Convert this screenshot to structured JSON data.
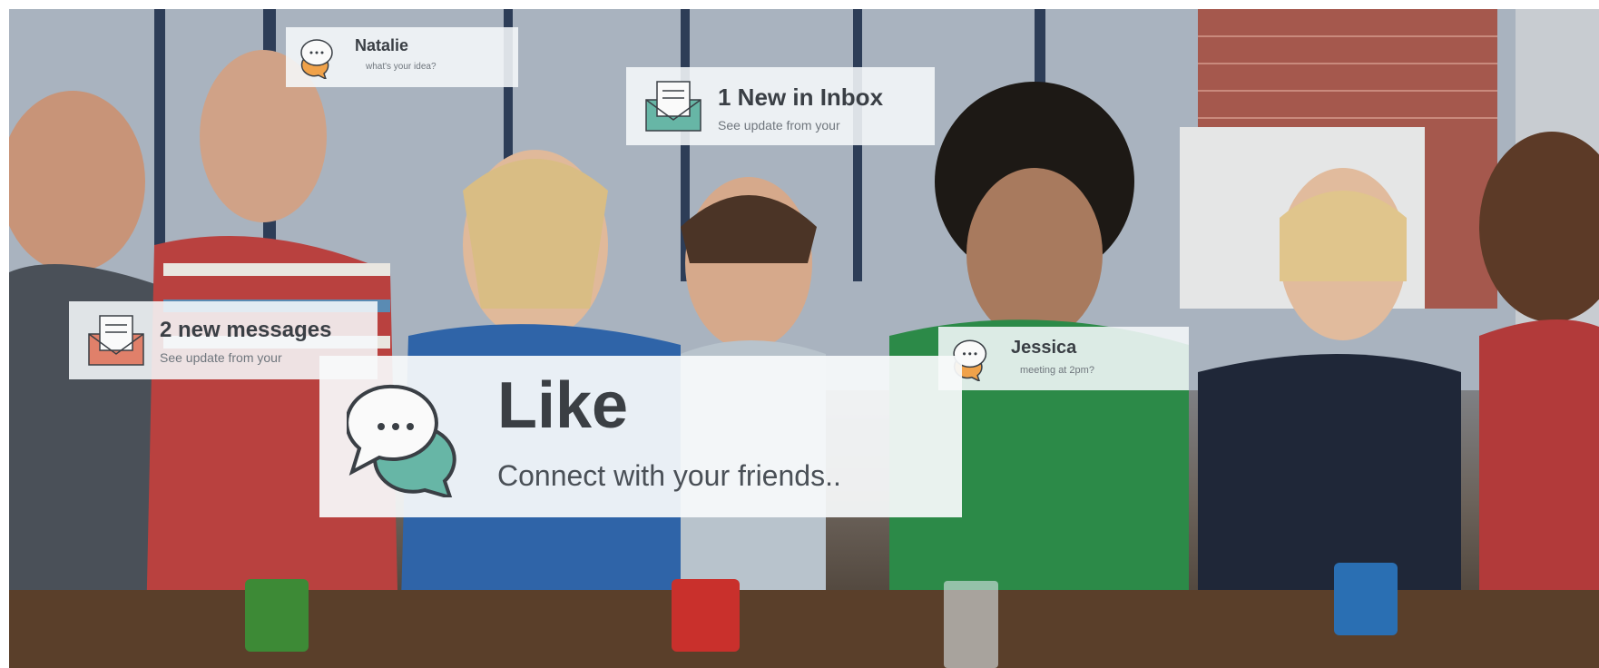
{
  "photo": {
    "description_icons": [
      "chat-bubbles-icon",
      "envelope-icon"
    ]
  },
  "notifications": {
    "natalie": {
      "name": "Natalie",
      "message": "what's your idea?"
    },
    "inbox": {
      "title": "1 New in Inbox",
      "subtitle": "See update from your"
    },
    "messages": {
      "title": "2 new messages",
      "subtitle": "See update from your"
    },
    "jessica": {
      "name": "Jessica",
      "message": "meeting at 2pm?"
    }
  },
  "main_card": {
    "title": "Like",
    "tagline": "Connect with your friends.."
  },
  "colors": {
    "teal": "#67b6a6",
    "coral": "#e0806a",
    "orange": "#f0a24a",
    "dark_text": "#3a3f45"
  }
}
